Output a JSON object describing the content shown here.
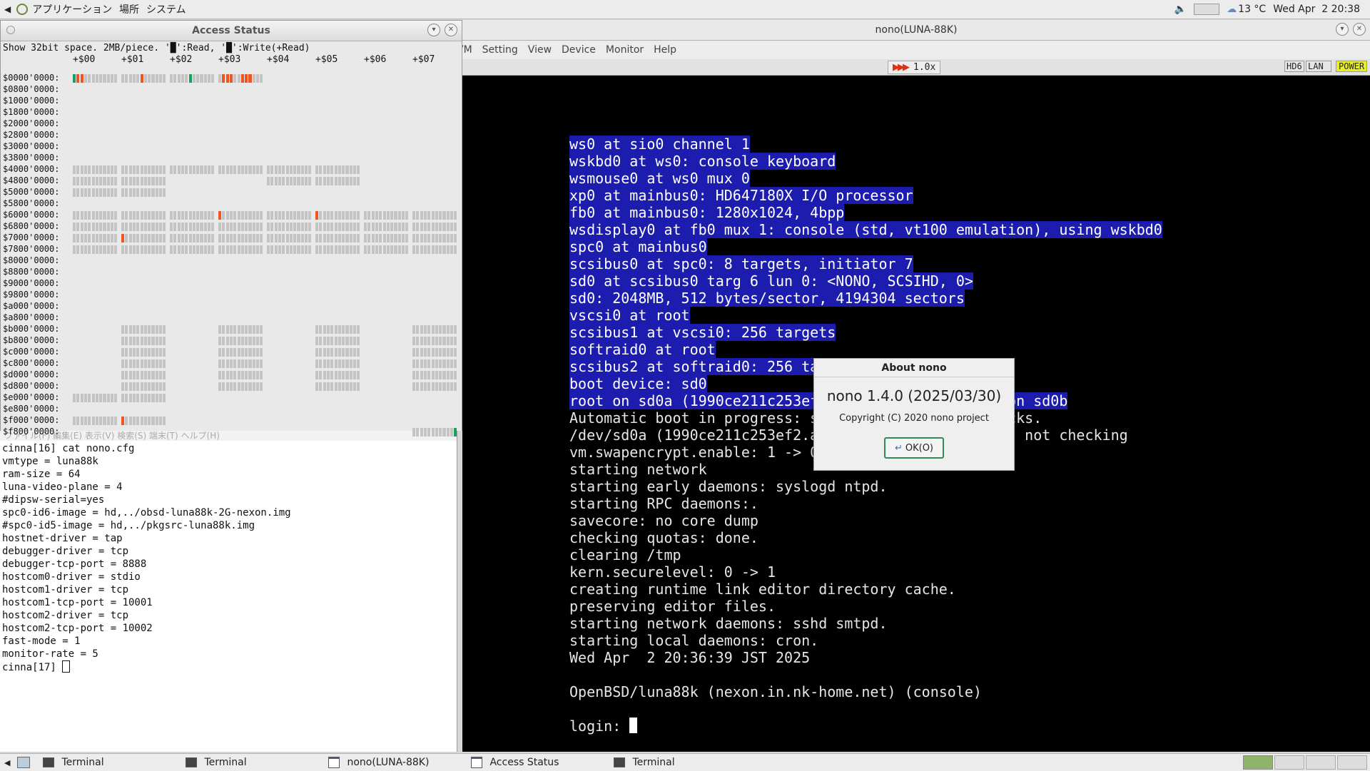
{
  "top_panel": {
    "menu_apps": "アプリケーション",
    "menu_places": "場所",
    "menu_system": "システム",
    "weather": "13 °C",
    "clock": "Wed Apr  2 20:38"
  },
  "access": {
    "title": "Access Status",
    "info": "Show 32bit space. 2MB/piece. '█':Read, '█':Write(+Read)",
    "cols": [
      "+$00",
      "+$01",
      "+$02",
      "+$03",
      "+$04",
      "+$05",
      "+$06",
      "+$07"
    ],
    "rows": [
      "$0000'0000:",
      "$0800'0000:",
      "$1000'0000:",
      "$1800'0000:",
      "$2000'0000:",
      "$2800'0000:",
      "$3000'0000:",
      "$3800'0000:",
      "$4000'0000:",
      "$4800'0000:",
      "$5000'0000:",
      "$5800'0000:",
      "$6000'0000:",
      "$6800'0000:",
      "$7000'0000:",
      "$7800'0000:",
      "$8000'0000:",
      "$8800'0000:",
      "$9000'0000:",
      "$9800'0000:",
      "$a000'0000:",
      "$a800'0000:",
      "$b000'0000:",
      "$b800'0000:",
      "$c000'0000:",
      "$c800'0000:",
      "$d000'0000:",
      "$d800'0000:",
      "$e000'0000:",
      "$e800'0000:",
      "$f000'0000:",
      "$f800'0000:"
    ],
    "colors": {
      "read": "#1aa060",
      "write": "#ee5522",
      "idle": "#c4c4c4"
    }
  },
  "nono": {
    "title": "nono(LUNA-88K)",
    "menus": [
      "VM",
      "Setting",
      "View",
      "Device",
      "Monitor",
      "Help"
    ],
    "speed": "1.0x",
    "indicators": [
      "HD6",
      "LAN",
      "POWER"
    ],
    "lines": [
      {
        "t": "ws0 at sio0 channel 1",
        "hl": true
      },
      {
        "t": "wskbd0 at ws0: console keyboard",
        "hl": true
      },
      {
        "t": "wsmouse0 at ws0 mux 0",
        "hl": true
      },
      {
        "t": "xp0 at mainbus0: HD647180X I/O processor",
        "hl": true
      },
      {
        "t": "fb0 at mainbus0: 1280x1024, 4bpp",
        "hl": true
      },
      {
        "t": "wsdisplay0 at fb0 mux 1: console (std, vt100 emulation), using wskbd0",
        "hl": true
      },
      {
        "t": "spc0 at mainbus0",
        "hl": true
      },
      {
        "t": "scsibus0 at spc0: 8 targets, initiator 7",
        "hl": true
      },
      {
        "t": "sd0 at scsibus0 targ 6 lun 0: <NONO, SCSIHD, 0>",
        "hl": true
      },
      {
        "t": "sd0: 2048MB, 512 bytes/sector, 4194304 sectors",
        "hl": true
      },
      {
        "t": "vscsi0 at root",
        "hl": true
      },
      {
        "t": "scsibus1 at vscsi0: 256 targets",
        "hl": true
      },
      {
        "t": "softraid0 at root",
        "hl": true
      },
      {
        "t": "scsibus2 at softraid0: 256 ta",
        "hl": true
      },
      {
        "t": "boot device: sd0",
        "hl": true
      },
      {
        "t": "root on sd0a (1990ce211c253ef                      on sd0b",
        "hl": true
      },
      {
        "t": "Automatic boot in progress: s                      cks.",
        "hl": false
      },
      {
        "t": "/dev/sd0a (1990ce211c253ef2.a                      ; not checking",
        "hl": false
      },
      {
        "t": "vm.swapencrypt.enable: 1 -> 0",
        "hl": false
      },
      {
        "t": "starting network",
        "hl": false
      },
      {
        "t": "starting early daemons: syslogd ntpd.",
        "hl": false
      },
      {
        "t": "starting RPC daemons:.",
        "hl": false
      },
      {
        "t": "savecore: no core dump",
        "hl": false
      },
      {
        "t": "checking quotas: done.",
        "hl": false
      },
      {
        "t": "clearing /tmp",
        "hl": false
      },
      {
        "t": "kern.securelevel: 0 -> 1",
        "hl": false
      },
      {
        "t": "creating runtime link editor directory cache.",
        "hl": false
      },
      {
        "t": "preserving editor files.",
        "hl": false
      },
      {
        "t": "starting network daemons: sshd smtpd.",
        "hl": false
      },
      {
        "t": "starting local daemons: cron.",
        "hl": false
      },
      {
        "t": "Wed Apr  2 20:36:39 JST 2025",
        "hl": false
      },
      {
        "t": "",
        "hl": false
      },
      {
        "t": "OpenBSD/luna88k (nexon.in.nk-home.net) (console)",
        "hl": false
      },
      {
        "t": "",
        "hl": false
      },
      {
        "t": "login: ",
        "hl": false
      }
    ]
  },
  "about": {
    "title": "About nono",
    "version": "nono 1.4.0 (2025/03/30)",
    "copyright": "Copyright (C) 2020 nono project",
    "ok": "OK(O)"
  },
  "terminal": {
    "menu": "ファイル(F)  編集(E)  表示(V)  検索(S)  端末(T)  ヘルプ(H)",
    "lines": [
      "cinna[16] cat nono.cfg",
      "vmtype = luna88k",
      "ram-size = 64",
      "luna-video-plane = 4",
      "#dipsw-serial=yes",
      "spc0-id6-image = hd,../obsd-luna88k-2G-nexon.img",
      "#spc0-id5-image = hd,../pkgsrc-luna88k.img",
      "hostnet-driver = tap",
      "debugger-driver = tcp",
      "debugger-tcp-port = 8888",
      "hostcom0-driver = stdio",
      "hostcom1-driver = tcp",
      "hostcom1-tcp-port = 10001",
      "hostcom2-driver = tcp",
      "hostcom2-tcp-port = 10002",
      "fast-mode = 1",
      "monitor-rate = 5",
      "cinna[17] "
    ]
  },
  "taskbar": [
    "Terminal",
    "Terminal",
    "nono(LUNA-88K)",
    "Access Status",
    "Terminal"
  ]
}
